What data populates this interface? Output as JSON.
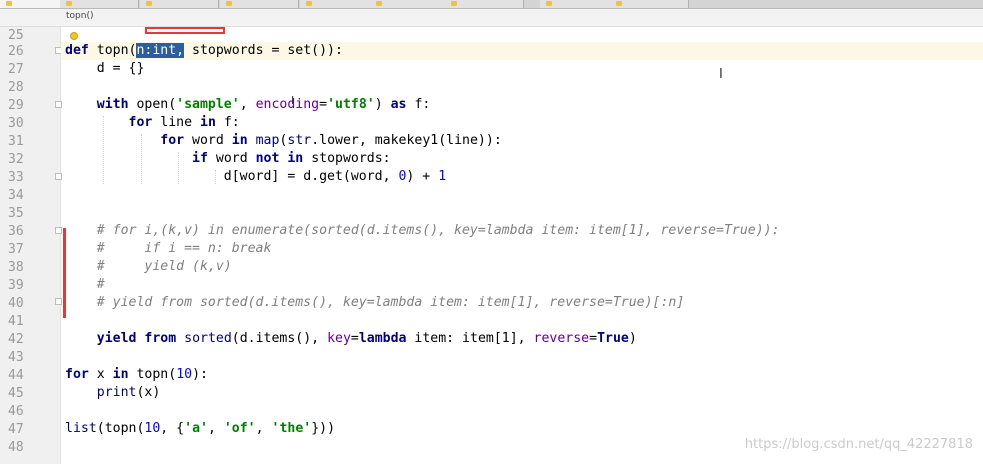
{
  "breadcrumb": "topn()",
  "line_numbers": [
    "25",
    "26",
    "27",
    "28",
    "29",
    "30",
    "31",
    "32",
    "33",
    "34",
    "35",
    "36",
    "37",
    "38",
    "39",
    "40",
    "41",
    "42",
    "43",
    "44",
    "45",
    "46",
    "47",
    "48"
  ],
  "code": {
    "l26": {
      "def": "def",
      "name": " topn(",
      "param": "n:int,",
      "rest": " stopwords = set()):"
    },
    "l27": "    d = {}",
    "l29": {
      "with": "with",
      "open": " open(",
      "s1": "'sample'",
      "c1": ", ",
      "enc": "encoding",
      "eq": "=",
      "s2": "'utf8'",
      "c2": ") ",
      "as": "as",
      "f": " f:"
    },
    "l30": {
      "ind": "        ",
      "for": "for",
      "mid": " line ",
      "in": "in",
      "rest": " f:"
    },
    "l31": {
      "ind": "            ",
      "for": "for",
      "mid": " word ",
      "in": "in",
      "sp": " ",
      "map": "map",
      "p": "(",
      "str": "str",
      "rest": ".lower, makekey1(line)):"
    },
    "l32": {
      "ind": "                ",
      "if": "if",
      "mid": " word ",
      "not": "not",
      "sp": " ",
      "in": "in",
      "rest": " stopwords:"
    },
    "l33": {
      "ind": "                    ",
      "pre": "d[word] = d.get(word, ",
      "n0": "0",
      "mid": ") + ",
      "n1": "1"
    },
    "l36": "    # for i,(k,v) in enumerate(sorted(d.items(), key=lambda item: item[1], reverse=True)):",
    "l37": "    #     if i == n: break",
    "l38": "    #     yield (k,v)",
    "l39": "    #",
    "l40": "    # yield from sorted(d.items(), key=lambda item: item[1], reverse=True)[:n]",
    "l42": {
      "ind": "    ",
      "yield": "yield",
      "sp": " ",
      "from": "from",
      "sp2": " ",
      "sorted": "sorted",
      "a": "(d.items(), ",
      "key": "key",
      "eq": "=",
      "lambda": "lambda",
      "b": " item: item[1], ",
      "rev": "reverse",
      "eq2": "=",
      "true": "True",
      "c": ")"
    },
    "l44": {
      "for": "for",
      "mid": " x ",
      "in": "in",
      "a": " topn(",
      "n": "10",
      "b": "):"
    },
    "l45": {
      "ind": "    ",
      "print": "print",
      "rest": "(x)"
    },
    "l47": {
      "list": "list",
      "a": "(topn(",
      "n": "10",
      "b": ", {",
      "s1": "'a'",
      "c1": ", ",
      "s2": "'of'",
      "c2": ", ",
      "s3": "'the'",
      "c": "}))"
    }
  },
  "watermark": "https://blog.csdn.net/qq_42227818",
  "colors": {
    "keyword": "#000080",
    "string": "#008000",
    "number": "#0000ff",
    "comment": "#808080",
    "kwarg": "#660099",
    "annotation": "#e53935"
  }
}
